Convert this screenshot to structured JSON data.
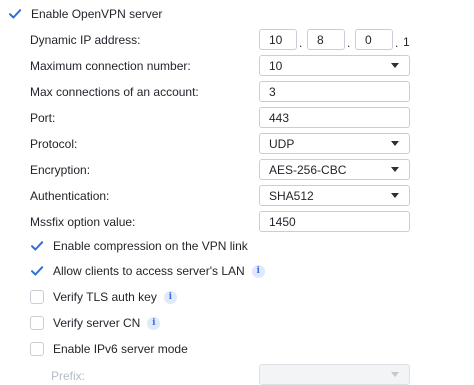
{
  "enable_server": {
    "label": "Enable OpenVPN server",
    "checked": true
  },
  "dynamic_ip": {
    "label": "Dynamic IP address:",
    "octets": [
      "10",
      "8",
      "0"
    ],
    "last_octet": "1",
    "separator": "."
  },
  "max_connections": {
    "label": "Maximum connection number:",
    "value": "10"
  },
  "max_per_account": {
    "label": "Max connections of an account:",
    "value": "3"
  },
  "port": {
    "label": "Port:",
    "value": "443"
  },
  "protocol": {
    "label": "Protocol:",
    "value": "UDP"
  },
  "encryption": {
    "label": "Encryption:",
    "value": "AES-256-CBC"
  },
  "authentication": {
    "label": "Authentication:",
    "value": "SHA512"
  },
  "mssfix": {
    "label": "Mssfix option value:",
    "value": "1450"
  },
  "options": [
    {
      "label": "Enable compression on the VPN link",
      "checked": true,
      "info": false
    },
    {
      "label": "Allow clients to access server's LAN",
      "checked": true,
      "info": true
    },
    {
      "label": "Verify TLS auth key",
      "checked": false,
      "info": true
    },
    {
      "label": "Verify server CN",
      "checked": false,
      "info": true
    },
    {
      "label": "Enable IPv6 server mode",
      "checked": false,
      "info": false
    }
  ],
  "prefix": {
    "label": "Prefix:",
    "value": ""
  },
  "info_glyph": "i",
  "colors": {
    "accent": "#2f6fd6",
    "border": "#c9ced6",
    "text": "#1f2329",
    "disabled": "#b6bcc4"
  }
}
